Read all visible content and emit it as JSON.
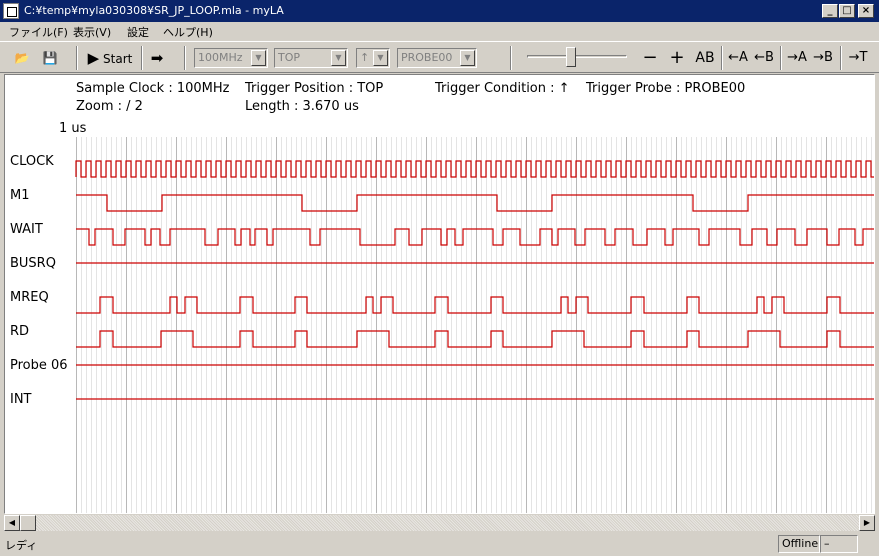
{
  "window": {
    "title": "C:¥temp¥myla030308¥SR_JP_LOOP.mla - myLA",
    "min_glyph": "_",
    "max_glyph": "□",
    "close_glyph": "×"
  },
  "menu": [
    "ファイル(F)",
    "表示(V)",
    "設定",
    "ヘルプ(H)"
  ],
  "toolbar": {
    "open_glyph": "📂",
    "save_glyph": "💾",
    "start_label": "Start",
    "start_glyph": "▶",
    "next_glyph": "➡",
    "clock_value": "100MHz",
    "position_value": "TOP",
    "condition_value": "↑",
    "probe_value": "PROBE00",
    "minus_label": "−",
    "plus_label": "+",
    "ab_label": "AB",
    "left_a_label": "←A",
    "left_b_label": "←B",
    "right_a_label": "→A",
    "right_b_label": "→B",
    "right_t_label": "→T"
  },
  "info": {
    "sample_clock": "Sample Clock : 100MHz",
    "trigger_position": "Trigger Position : TOP",
    "trigger_condition": "Trigger Condition :  ↑",
    "trigger_probe": "Trigger Probe : PROBE00",
    "zoom": "Zoom :  /    2",
    "length": "Length : 3.670 us",
    "scale": "1 us"
  },
  "signals": [
    "CLOCK",
    "M1",
    "WAIT",
    "BUSRQ",
    "MREQ",
    "RD",
    "Probe 06",
    "INT"
  ],
  "colors": {
    "trace": "#cc0000",
    "grid_major": "#b8b8b8",
    "grid_minor": "#e4e4e4",
    "titlebar": "#0a246a"
  },
  "status": {
    "text": "レディ",
    "mode": "Offline",
    "extra": "–"
  },
  "scroll": {
    "left_glyph": "◀",
    "right_glyph": "▶"
  }
}
